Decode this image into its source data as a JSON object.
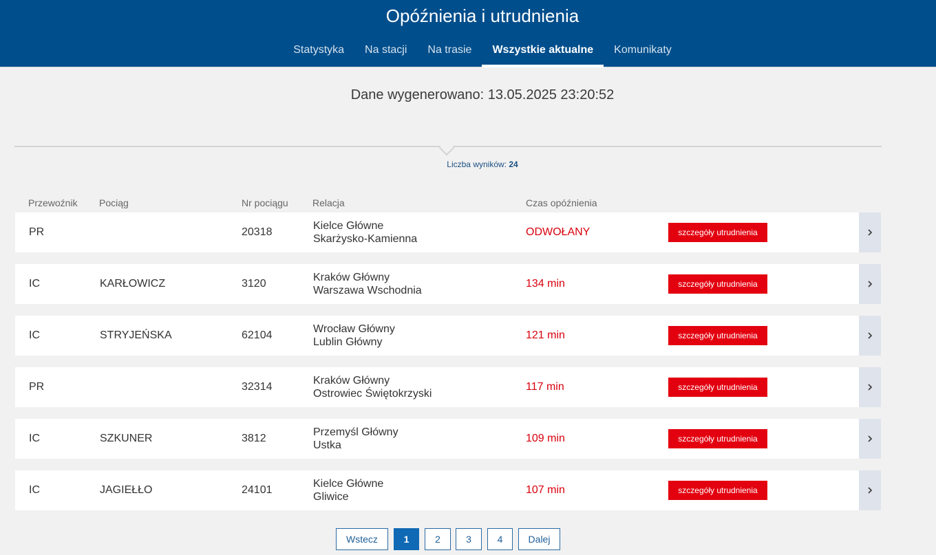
{
  "header": {
    "title": "Opóźnienia i utrudnienia",
    "tabs": [
      {
        "label": "Statystyka",
        "active": false
      },
      {
        "label": "Na stacji",
        "active": false
      },
      {
        "label": "Na trasie",
        "active": false
      },
      {
        "label": "Wszystkie aktualne",
        "active": true
      },
      {
        "label": "Komunikaty",
        "active": false
      }
    ]
  },
  "generated": "Dane wygenerowano: 13.05.2025 23:20:52",
  "results": {
    "label": "Liczba wyników:",
    "count": "24"
  },
  "columns": {
    "carrier": "Przewoźnik",
    "train": "Pociąg",
    "number": "Nr pociągu",
    "relation": "Relacja",
    "delay": "Czas opóźnienia"
  },
  "details_label": "szczegóły utrudnienia",
  "rows": [
    {
      "carrier": "PR",
      "name": "",
      "number": "20318",
      "from": "Kielce Główne",
      "to": "Skarżysko-Kamienna",
      "delay": "ODWOŁANY"
    },
    {
      "carrier": "IC",
      "name": "KARŁOWICZ",
      "number": "3120",
      "from": "Kraków Główny",
      "to": "Warszawa Wschodnia",
      "delay": "134 min"
    },
    {
      "carrier": "IC",
      "name": "STRYJEŃSKA",
      "number": "62104",
      "from": "Wrocław Główny",
      "to": "Lublin Główny",
      "delay": "121 min"
    },
    {
      "carrier": "PR",
      "name": "",
      "number": "32314",
      "from": "Kraków Główny",
      "to": "Ostrowiec Świętokrzyski",
      "delay": "117 min"
    },
    {
      "carrier": "IC",
      "name": "SZKUNER",
      "number": "3812",
      "from": "Przemyśl Główny",
      "to": "Ustka",
      "delay": "109 min"
    },
    {
      "carrier": "IC",
      "name": "JAGIEŁŁO",
      "number": "24101",
      "from": "Kielce Główne",
      "to": "Gliwice",
      "delay": "107 min"
    }
  ],
  "pagination": {
    "prev": "Wstecz",
    "pages": [
      "1",
      "2",
      "3",
      "4"
    ],
    "current": "1",
    "next": "Dalej"
  },
  "colors": {
    "header_bg": "#004e8c",
    "delay_red": "#d9000d",
    "button_red": "#e3000f",
    "page_active": "#0f69b4"
  }
}
